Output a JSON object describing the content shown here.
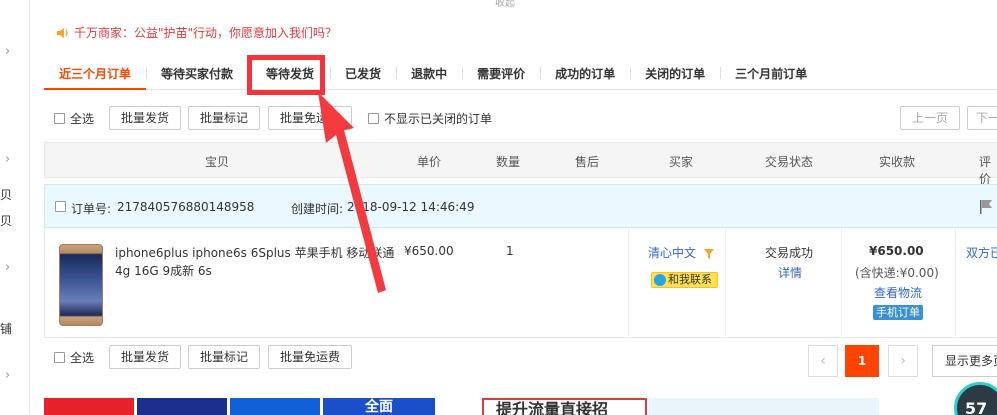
{
  "collapse_label": "收起",
  "left_rail": {
    "chars": [
      "贝",
      "贝",
      "铺"
    ]
  },
  "notice": {
    "text": "千万商家：公益\"护苗\"行动，你愿意加入我们吗？"
  },
  "tabs": [
    {
      "label": "近三个月订单",
      "active": true
    },
    {
      "label": "等待买家付款"
    },
    {
      "label": "等待发货"
    },
    {
      "label": "已发货"
    },
    {
      "label": "退款中"
    },
    {
      "label": "需要评价"
    },
    {
      "label": "成功的订单"
    },
    {
      "label": "关闭的订单"
    },
    {
      "label": "三个月前订单"
    }
  ],
  "toolbar": {
    "select_all": "全选",
    "batch_ship": "批量发货",
    "batch_mark": "批量标记",
    "batch_free_shipping": "批量免运费",
    "hide_closed": "不显示已关闭的订单",
    "prev_page": "上一页",
    "next_page": "下一"
  },
  "table_headers": {
    "item": "宝贝",
    "unit_price": "单价",
    "quantity": "数量",
    "after_sale": "售后",
    "buyer": "买家",
    "status": "交易状态",
    "paid": "实收款",
    "review": "评价"
  },
  "order": {
    "order_no_label": "订单号:",
    "order_no": "217840576880148958",
    "created_label": "创建时间:",
    "created_time": "2018-09-12 14:46:49",
    "title": "iphone6plus iphone6s 6Splus 苹果手机 移动联通4g 16G 9成新 6s",
    "price": "¥650.00",
    "quantity": "1",
    "buyer_name": "清心中文",
    "contact": "和我联系",
    "status": "交易成功",
    "detail": "详情",
    "paid": "¥650.00",
    "shipping": "(含快递:¥0.00)",
    "track": "查看物流",
    "mobile_tag": "手机订单",
    "review": "双方已"
  },
  "bottom": {
    "select_all": "全选",
    "batch_ship": "批量发货",
    "batch_mark": "批量标记",
    "batch_free_shipping": "批量免运费",
    "current_page": "1",
    "show_more": "显示更多页"
  },
  "banners": {
    "text": "提升流量直接招",
    "quanmian": "全面"
  },
  "speed_badge": "57",
  "colors": {
    "accent": "#ff4400",
    "highlight": "#f5343a",
    "link": "#3366cc"
  }
}
